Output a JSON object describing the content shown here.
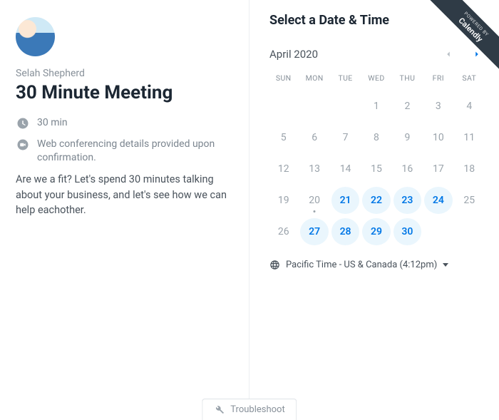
{
  "ribbon": {
    "small": "POWERED BY",
    "big": "Calendly"
  },
  "host": {
    "name": "Selah Shepherd",
    "event_title": "30 Minute Meeting",
    "duration": "30 min",
    "location": "Web conferencing details provided upon confirmation.",
    "description": "Are we a fit? Let's spend 30 minutes talking about your business, and let's see how we can help eachother."
  },
  "picker": {
    "title": "Select a Date & Time",
    "month": "April 2020",
    "days_of_week": [
      "SUN",
      "MON",
      "TUE",
      "WED",
      "THU",
      "FRI",
      "SAT"
    ],
    "cells": [
      {
        "n": "",
        "a": false
      },
      {
        "n": "",
        "a": false
      },
      {
        "n": "",
        "a": false
      },
      {
        "n": "1",
        "a": false
      },
      {
        "n": "2",
        "a": false
      },
      {
        "n": "3",
        "a": false
      },
      {
        "n": "4",
        "a": false
      },
      {
        "n": "5",
        "a": false
      },
      {
        "n": "6",
        "a": false
      },
      {
        "n": "7",
        "a": false
      },
      {
        "n": "8",
        "a": false
      },
      {
        "n": "9",
        "a": false
      },
      {
        "n": "10",
        "a": false
      },
      {
        "n": "11",
        "a": false
      },
      {
        "n": "12",
        "a": false
      },
      {
        "n": "13",
        "a": false
      },
      {
        "n": "14",
        "a": false
      },
      {
        "n": "15",
        "a": false
      },
      {
        "n": "16",
        "a": false
      },
      {
        "n": "17",
        "a": false
      },
      {
        "n": "18",
        "a": false
      },
      {
        "n": "19",
        "a": false
      },
      {
        "n": "20",
        "a": false,
        "dot": true
      },
      {
        "n": "21",
        "a": true
      },
      {
        "n": "22",
        "a": true
      },
      {
        "n": "23",
        "a": true
      },
      {
        "n": "24",
        "a": true
      },
      {
        "n": "25",
        "a": false
      },
      {
        "n": "26",
        "a": false
      },
      {
        "n": "27",
        "a": true
      },
      {
        "n": "28",
        "a": true
      },
      {
        "n": "29",
        "a": true
      },
      {
        "n": "30",
        "a": true
      },
      {
        "n": "",
        "a": false
      },
      {
        "n": "",
        "a": false
      }
    ],
    "timezone": "Pacific Time - US & Canada (4:12pm)"
  },
  "troubleshoot": "Troubleshoot"
}
